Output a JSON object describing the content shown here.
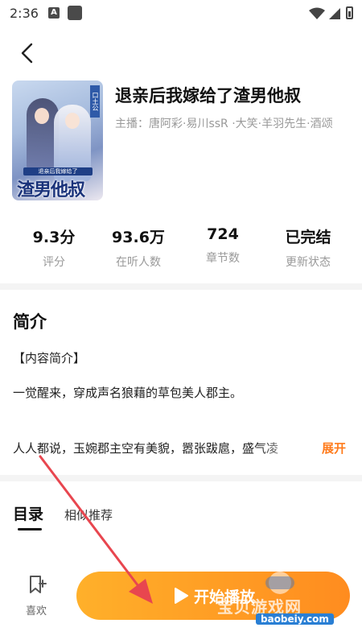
{
  "status_bar": {
    "time": "2:36",
    "notif_a": "A"
  },
  "book": {
    "title": "退亲后我嫁给了渣男他叔",
    "hosts": "主播：唐阿彩·易川ssR ·大笑·羊羽先生·酒颂",
    "cover": {
      "badge": "口土公",
      "subtitle": "退亲后我嫁给了",
      "title_art": "渣男他叔"
    }
  },
  "stats": [
    {
      "value": "9.3分",
      "label": "评分"
    },
    {
      "value": "93.6万",
      "label": "在听人数"
    },
    {
      "value": "724",
      "label": "章节数"
    },
    {
      "value": "已完结",
      "label": "更新状态"
    }
  ],
  "intro": {
    "heading": "简介",
    "line1": "【内容简介】",
    "line2": "一觉醒来，穿成声名狼藉的草包美人郡主。",
    "line3": "人人都说，玉婉郡主空有美貌，嚣张跋扈，盛气凌",
    "expand": "展开"
  },
  "tabs": {
    "catalog": "目录",
    "similar": "相似推荐"
  },
  "bottom": {
    "favorite": "喜欢",
    "play": "开始播放"
  },
  "watermark": {
    "text": "宝贝游戏网",
    "site": "baobeiy.com"
  },
  "colors": {
    "accent": "#ff8c1f",
    "arrow": "#e8464f"
  }
}
